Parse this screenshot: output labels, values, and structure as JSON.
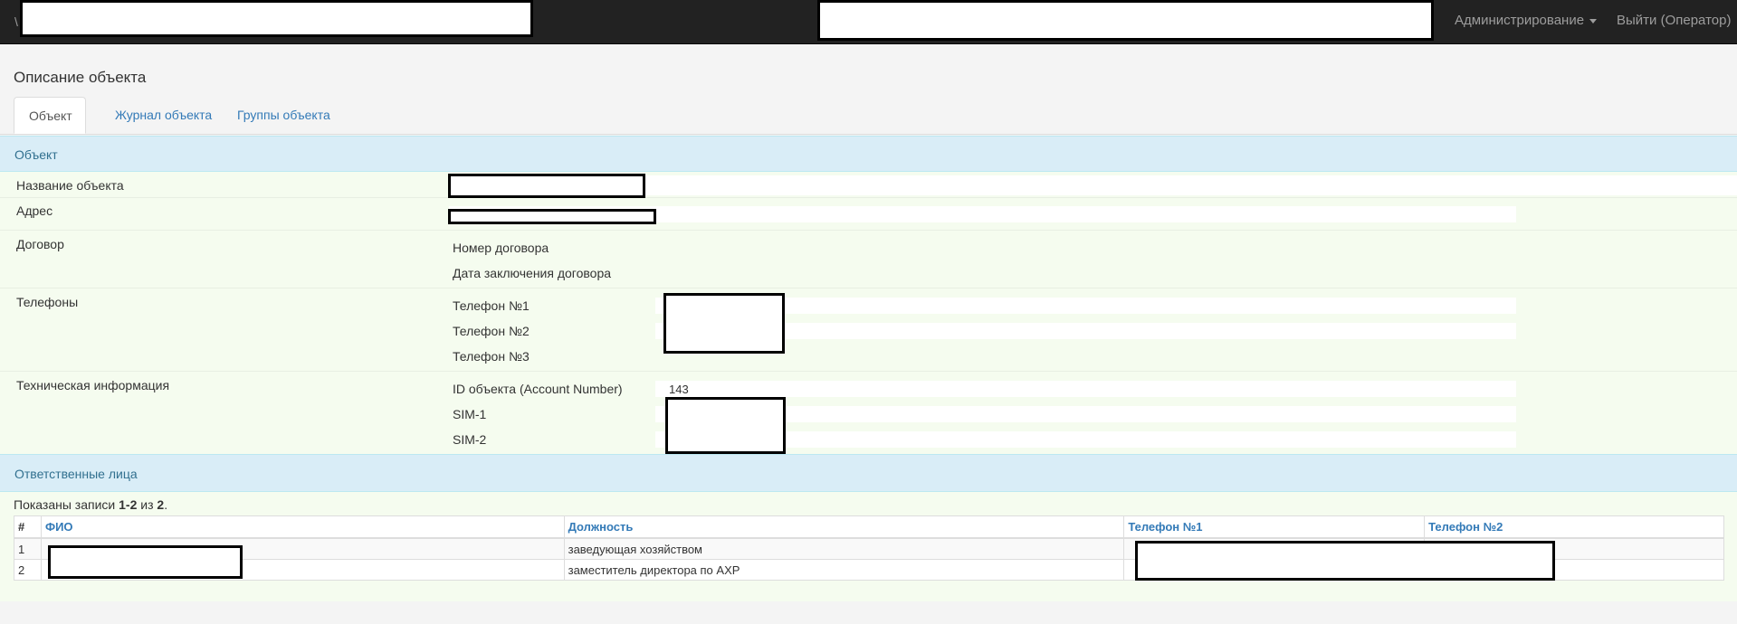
{
  "navbar": {
    "brand": "\\",
    "admin_menu": "Администрирование",
    "logout": "Выйти (Оператор)"
  },
  "page_title": "Описание объекта",
  "tabs": [
    {
      "label": "Объект",
      "active": true
    },
    {
      "label": "Журнал объекта",
      "active": false
    },
    {
      "label": "Группы объекта",
      "active": false
    }
  ],
  "object_panel": {
    "heading": "Объект",
    "name_label": "Название объекта",
    "address_label": "Адрес",
    "contract_label": "Договор",
    "contract_number_label": "Номер договора",
    "contract_date_label": "Дата заключения договора",
    "phones_label": "Телефоны",
    "phone1_label": "Телефон №1",
    "phone2_label": "Телефон №2",
    "phone3_label": "Телефон №3",
    "tech_label": "Техническая информация",
    "account_id_label": "ID объекта (Account Number)",
    "account_id_value": "143",
    "sim1_label": "SIM-1",
    "sim2_label": "SIM-2"
  },
  "responsible_panel": {
    "heading": "Ответственные лица",
    "records_prefix": "Показаны записи ",
    "records_range": "1-2",
    "records_of": " из ",
    "records_total": "2",
    "records_suffix": ".",
    "columns": [
      "#",
      "ФИО",
      "Должность",
      "Телефон №1",
      "Телефон №2"
    ],
    "rows": [
      {
        "num": "1",
        "position": "заведующая хозяйством"
      },
      {
        "num": "2",
        "position": "заместитель директора по АХР"
      }
    ]
  }
}
